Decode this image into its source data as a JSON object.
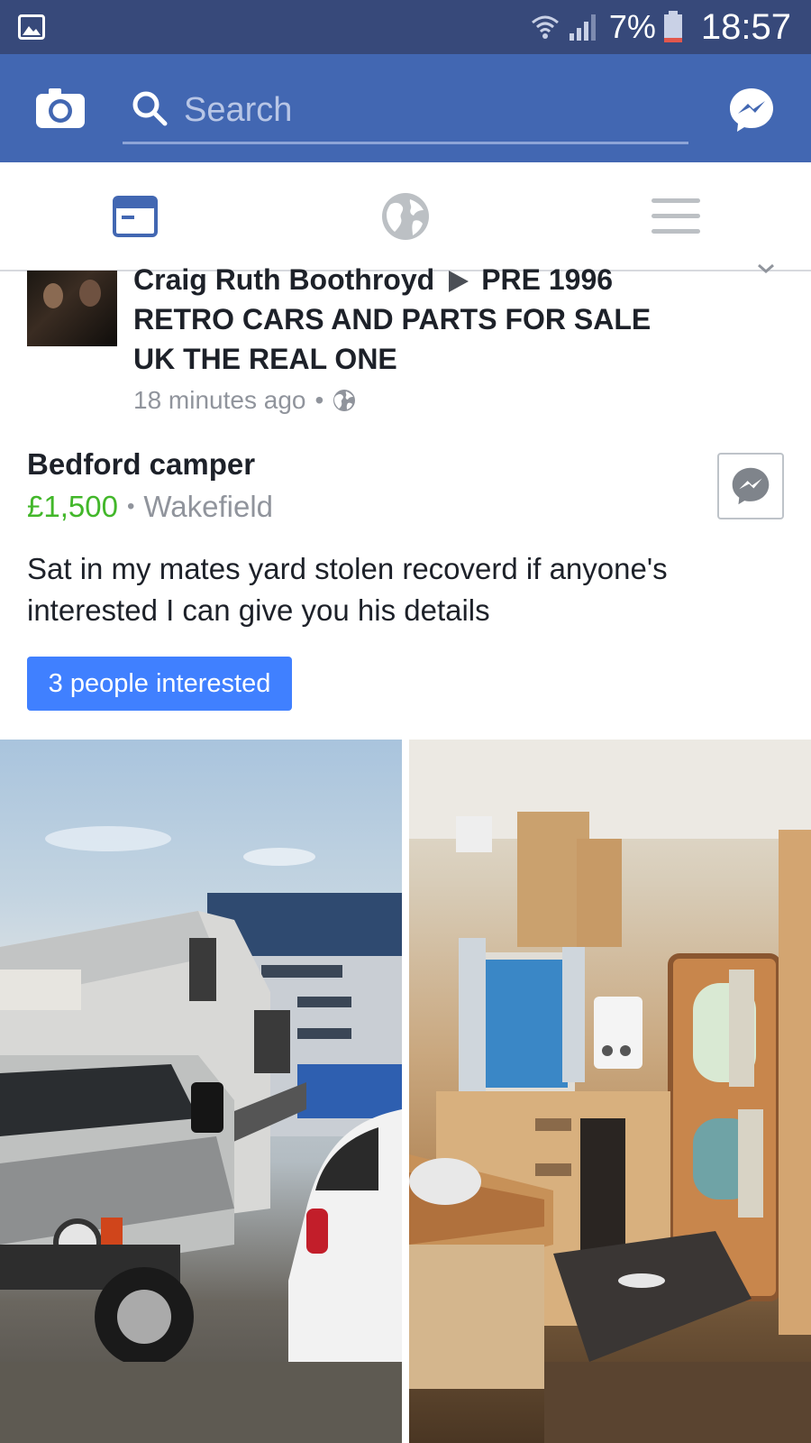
{
  "status_bar": {
    "battery_percent": "7%",
    "time": "18:57",
    "icons": [
      "gallery-icon",
      "wifi-icon",
      "signal-icon",
      "battery-icon"
    ]
  },
  "app_bar": {
    "search_placeholder": "Search",
    "icons": [
      "camera-icon",
      "search-icon",
      "messenger-icon"
    ],
    "background": "#4267b2"
  },
  "tabs": [
    {
      "name": "news-feed",
      "icon": "news-feed-icon",
      "active": true
    },
    {
      "name": "notifications",
      "icon": "globe-icon",
      "active": false
    },
    {
      "name": "menu",
      "icon": "hamburger-menu-icon",
      "active": false
    }
  ],
  "post": {
    "author": "Craig Ruth Boothroyd",
    "group": "PRE 1996 RETRO CARS AND PARTS FOR SALE UK THE REAL ONE",
    "timestamp": "18 minutes ago",
    "separator": "•",
    "privacy_icon": "globe-icon"
  },
  "listing": {
    "title": "Bedford camper",
    "price": "£1,500",
    "separator": "•",
    "location": "Wakefield",
    "description": "Sat in my mates yard stolen recoverd if anyone's interested I can give you his details",
    "interested_label": "3 people interested",
    "price_color": "#42b72a",
    "button_color": "#4080ff"
  },
  "photos": [
    {
      "name": "camper-exterior-photo"
    },
    {
      "name": "camper-interior-photo"
    }
  ]
}
